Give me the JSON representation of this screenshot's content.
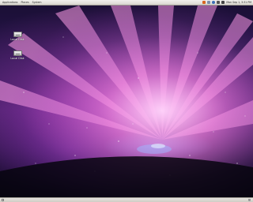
{
  "top_panel": {
    "menus": [
      {
        "label": "Applications"
      },
      {
        "label": "Places"
      },
      {
        "label": "System"
      }
    ],
    "tray_icons": [
      {
        "name": "firefox-icon",
        "color": "#d9661f"
      },
      {
        "name": "mail-icon",
        "color": "#7b8ea8"
      },
      {
        "name": "help-icon",
        "color": "#3b6fb6"
      },
      {
        "name": "network-icon",
        "color": "#555555"
      },
      {
        "name": "volume-icon",
        "color": "#444444"
      }
    ],
    "clock": "Mon Sep 1, 3:31 PM"
  },
  "desktop_icons": [
    {
      "name": "drive-icon-1",
      "label": "Local Disk"
    },
    {
      "name": "drive-icon-2",
      "label": "Local Disk"
    }
  ],
  "bottom_panel": {
    "show_desktop": "show-desktop-icon",
    "trash": "trash-icon"
  }
}
